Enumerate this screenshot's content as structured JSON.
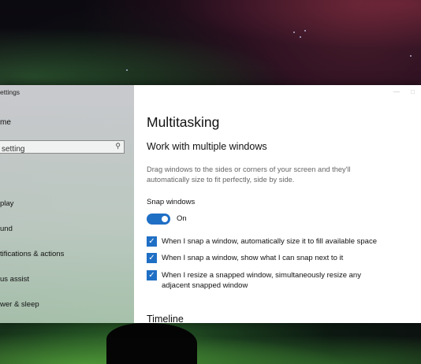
{
  "app_title": "ettings",
  "sidebar": {
    "home_label": "me",
    "search_placeholder": "setting",
    "items": [
      {
        "label": "play"
      },
      {
        "label": "und"
      },
      {
        "label": "tifications & actions"
      },
      {
        "label": "us assist"
      },
      {
        "label": "wer & sleep"
      }
    ]
  },
  "main": {
    "page_title": "Multitasking",
    "section_title": "Work with multiple windows",
    "description": "Drag windows to the sides or corners of your screen and they'll automatically size to fit perfectly, side by side.",
    "snap_label": "Snap windows",
    "snap_state": "On",
    "options": [
      {
        "label": "When I snap a window, automatically size it to fill available space",
        "checked": true
      },
      {
        "label": "When I snap a window, show what I can snap next to it",
        "checked": true
      },
      {
        "label": "When I resize a snapped window, simultaneously resize any adjacent snapped window",
        "checked": true
      }
    ],
    "next_section": "Timeline"
  },
  "colors": {
    "accent": "#1f6fc5"
  }
}
